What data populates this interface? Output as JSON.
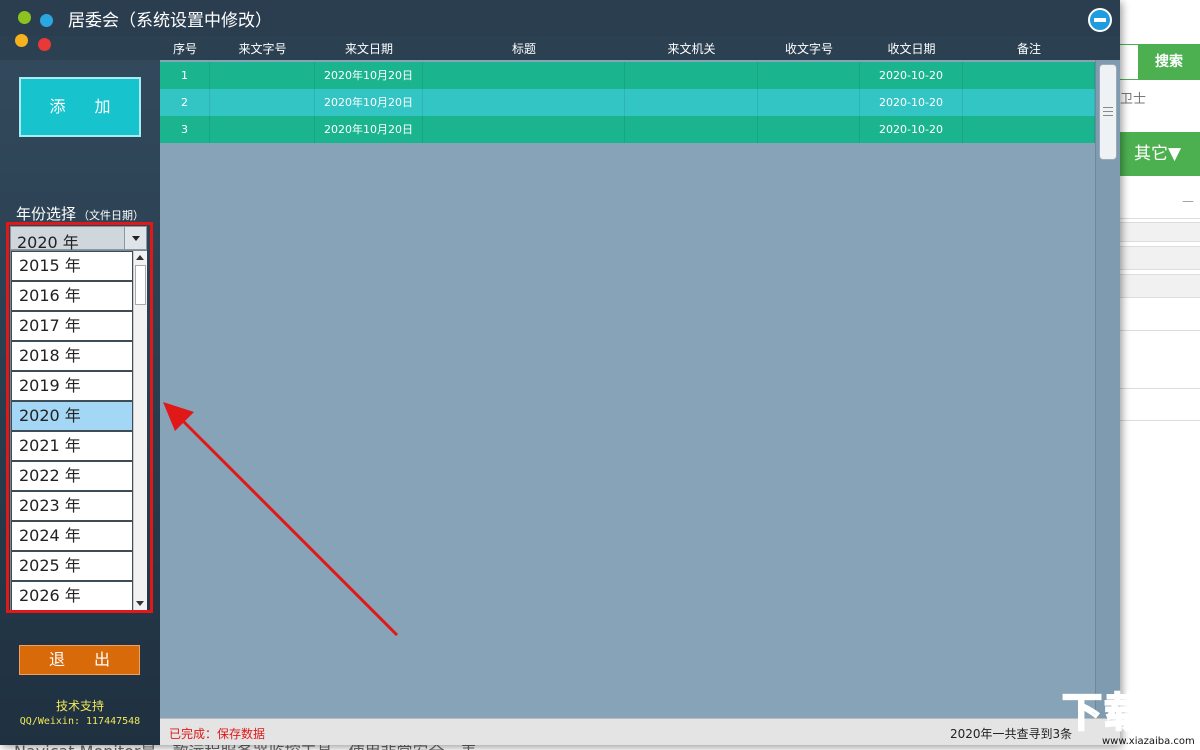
{
  "background_page": {
    "search_label": "搜索",
    "guard_text": "卫士",
    "other_label": "其它▼",
    "dash": "—",
    "bottom_text": "Navicat Monitor是一款远程服务器监控工具，使用非常安全，表"
  },
  "window": {
    "title": "居委会（系统设置中修改）"
  },
  "columns": [
    "序号",
    "来文字号",
    "来文日期",
    "标题",
    "来文机关",
    "收文字号",
    "收文日期",
    "备注"
  ],
  "rows": [
    {
      "seq": "1",
      "doc_no": "",
      "doc_date": "2020年10月20日",
      "title": "",
      "agency": "",
      "recv_no": "",
      "recv_date": "2020-10-20",
      "note": ""
    },
    {
      "seq": "2",
      "doc_no": "",
      "doc_date": "2020年10月20日",
      "title": "",
      "agency": "",
      "recv_no": "",
      "recv_date": "2020-10-20",
      "note": ""
    },
    {
      "seq": "3",
      "doc_no": "",
      "doc_date": "2020年10月20日",
      "title": "",
      "agency": "",
      "recv_no": "",
      "recv_date": "2020-10-20",
      "note": ""
    }
  ],
  "sidebar": {
    "add_label": "添 加",
    "year_label": "年份选择",
    "year_hint": "（文件日期）",
    "selected_year": "2020 年",
    "year_options": [
      "2015 年",
      "2016 年",
      "2017 年",
      "2018 年",
      "2019 年",
      "2020 年",
      "2021 年",
      "2022 年",
      "2023 年",
      "2024 年",
      "2025 年",
      "2026 年"
    ],
    "selected_index": 5,
    "exit_label": "退 出",
    "support_label": "技术支持",
    "support_contact": "QQ/Weixin: 117447548"
  },
  "status": {
    "left": "已完成：保存数据",
    "right": "2020年一共查寻到3条"
  },
  "watermark": {
    "text": "下载吧",
    "url": "www.xiazaiba.com"
  },
  "colors": {
    "row_odd": "#1ab58f",
    "row_even": "#33c4c4",
    "selected_option": "#a4d6f6",
    "highlight": "#e01818"
  }
}
